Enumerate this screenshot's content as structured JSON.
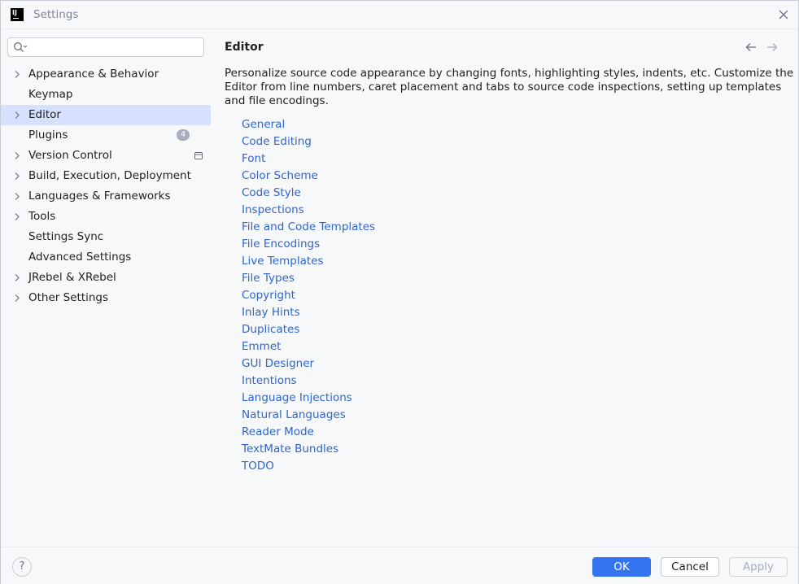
{
  "window": {
    "title": "Settings",
    "app_logo_text": "IJ"
  },
  "sidebar": {
    "search": {
      "placeholder": "",
      "value": ""
    },
    "items": [
      {
        "label": "Appearance & Behavior",
        "expandable": true
      },
      {
        "label": "Keymap",
        "expandable": false
      },
      {
        "label": "Editor",
        "expandable": true,
        "selected": true
      },
      {
        "label": "Plugins",
        "expandable": false,
        "badge": "4"
      },
      {
        "label": "Version Control",
        "expandable": true
      },
      {
        "label": "Build, Execution, Deployment",
        "expandable": true
      },
      {
        "label": "Languages & Frameworks",
        "expandable": true
      },
      {
        "label": "Tools",
        "expandable": true
      },
      {
        "label": "Settings Sync",
        "expandable": false
      },
      {
        "label": "Advanced Settings",
        "expandable": false
      },
      {
        "label": "JRebel & XRebel",
        "expandable": true
      },
      {
        "label": "Other Settings",
        "expandable": true
      }
    ]
  },
  "main": {
    "title": "Editor",
    "description": "Personalize source code appearance by changing fonts, highlighting styles, indents, etc. Customize the Editor from line numbers, caret placement and tabs to source code inspections, setting up templates and file encodings.",
    "links": [
      "General",
      "Code Editing",
      "Font",
      "Color Scheme",
      "Code Style",
      "Inspections",
      "File and Code Templates",
      "File Encodings",
      "Live Templates",
      "File Types",
      "Copyright",
      "Inlay Hints",
      "Duplicates",
      "Emmet",
      "GUI Designer",
      "Intentions",
      "Language Injections",
      "Natural Languages",
      "Reader Mode",
      "TextMate Bundles",
      "TODO"
    ]
  },
  "footer": {
    "help_label": "?",
    "ok_label": "OK",
    "cancel_label": "Cancel",
    "apply_label": "Apply"
  },
  "colors": {
    "accent": "#3574f0",
    "link": "#2f65ca",
    "selection": "#d5e1ff",
    "background": "#f7f8fa"
  }
}
